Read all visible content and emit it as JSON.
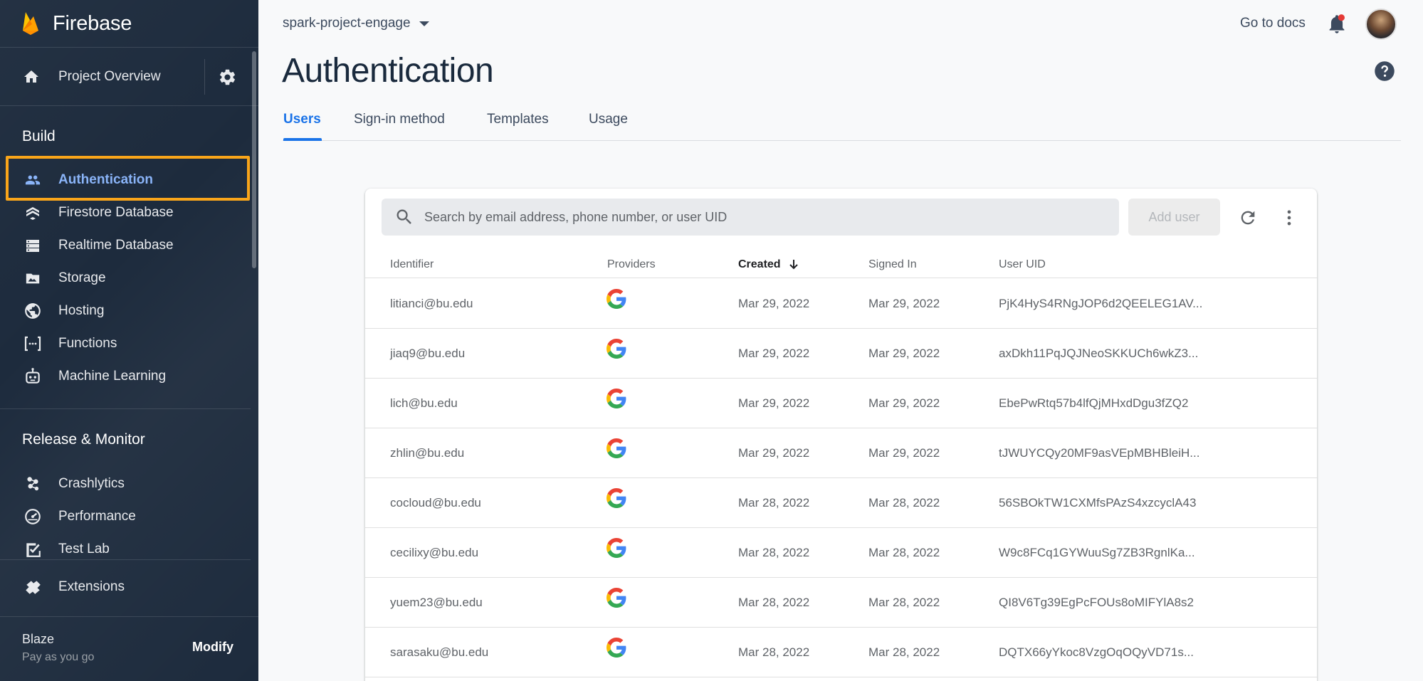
{
  "brand": {
    "name": "Firebase"
  },
  "sidebar": {
    "overview_label": "Project Overview",
    "build_title": "Build",
    "build_items": [
      {
        "label": "Authentication",
        "icon": "people-icon",
        "active": true
      },
      {
        "label": "Firestore Database",
        "icon": "firestore-icon"
      },
      {
        "label": "Realtime Database",
        "icon": "database-icon"
      },
      {
        "label": "Storage",
        "icon": "storage-icon"
      },
      {
        "label": "Hosting",
        "icon": "globe-icon"
      },
      {
        "label": "Functions",
        "icon": "functions-icon"
      },
      {
        "label": "Machine Learning",
        "icon": "robot-icon"
      }
    ],
    "release_title": "Release & Monitor",
    "release_items": [
      {
        "label": "Crashlytics",
        "icon": "crashlytics-icon"
      },
      {
        "label": "Performance",
        "icon": "speedometer-icon"
      },
      {
        "label": "Test Lab",
        "icon": "checklist-icon"
      }
    ],
    "extensions_label": "Extensions",
    "plan": {
      "name": "Blaze",
      "subtitle": "Pay as you go",
      "action": "Modify"
    }
  },
  "header": {
    "project": "spark-project-engage",
    "docs_link": "Go to docs",
    "title": "Authentication"
  },
  "tabs": [
    "Users",
    "Sign-in method",
    "Templates",
    "Usage"
  ],
  "toolbar": {
    "search_placeholder": "Search by email address, phone number, or user UID",
    "add_user": "Add user"
  },
  "table": {
    "columns": [
      "Identifier",
      "Providers",
      "Created",
      "Signed In",
      "User UID"
    ],
    "sorted_column": "Created",
    "rows": [
      {
        "identifier": "litianci@bu.edu",
        "provider": "google",
        "created": "Mar 29, 2022",
        "signed_in": "Mar 29, 2022",
        "uid": "PjK4HyS4RNgJOP6d2QEELEG1AV..."
      },
      {
        "identifier": "jiaq9@bu.edu",
        "provider": "google",
        "created": "Mar 29, 2022",
        "signed_in": "Mar 29, 2022",
        "uid": "axDkh11PqJQJNeoSKKUCh6wkZ3..."
      },
      {
        "identifier": "lich@bu.edu",
        "provider": "google",
        "created": "Mar 29, 2022",
        "signed_in": "Mar 29, 2022",
        "uid": "EbePwRtq57b4lfQjMHxdDgu3fZQ2"
      },
      {
        "identifier": "zhlin@bu.edu",
        "provider": "google",
        "created": "Mar 29, 2022",
        "signed_in": "Mar 29, 2022",
        "uid": "tJWUYCQy20MF9asVEpMBHBleiH..."
      },
      {
        "identifier": "cocloud@bu.edu",
        "provider": "google",
        "created": "Mar 28, 2022",
        "signed_in": "Mar 28, 2022",
        "uid": "56SBOkTW1CXMfsPAzS4xzcyclA43"
      },
      {
        "identifier": "cecilixy@bu.edu",
        "provider": "google",
        "created": "Mar 28, 2022",
        "signed_in": "Mar 28, 2022",
        "uid": "W9c8FCq1GYWuuSg7ZB3RgnlKa..."
      },
      {
        "identifier": "yuem23@bu.edu",
        "provider": "google",
        "created": "Mar 28, 2022",
        "signed_in": "Mar 28, 2022",
        "uid": "QI8V6Tg39EgPcFOUs8oMIFYlA8s2"
      },
      {
        "identifier": "sarasaku@bu.edu",
        "provider": "google",
        "created": "Mar 28, 2022",
        "signed_in": "Mar 28, 2022",
        "uid": "DQTX66yYkoc8VzgOqOQyVD71s..."
      }
    ]
  },
  "colors": {
    "sidebar_bg": "#1d2b3d",
    "accent": "#1a73e8",
    "highlight": "#f9a51a"
  }
}
